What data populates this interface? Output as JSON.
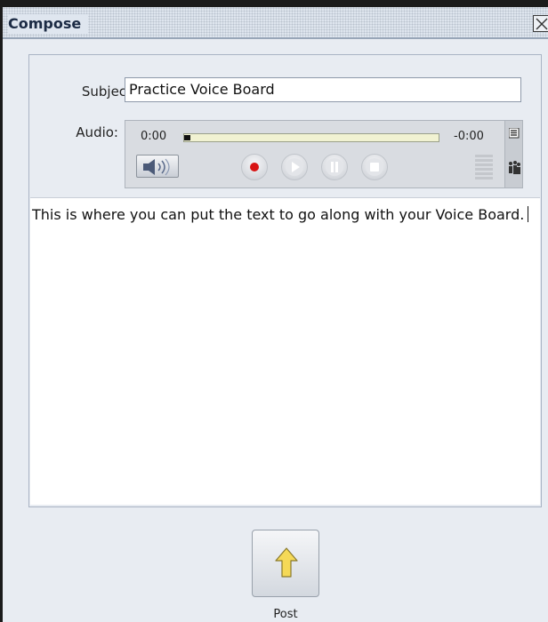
{
  "window": {
    "title": "Compose"
  },
  "form": {
    "subject_label": "Subject:",
    "subject_value": "Practice Voice Board",
    "audio_label": "Audio:"
  },
  "audio_player": {
    "current_time": "0:00",
    "remaining_time": "-0:00",
    "progress": 0,
    "icons": [
      "speaker-icon",
      "record-icon",
      "play-icon",
      "pause-icon",
      "stop-icon",
      "level-meter-icon",
      "menu-icon",
      "people-icon"
    ],
    "record_color": "#d81414"
  },
  "message": {
    "body": "This is where you can put the text to go along with your Voice Board."
  },
  "actions": {
    "post_label": "Post",
    "post_icon": "up-arrow-icon",
    "post_icon_color": "#f5d957"
  }
}
